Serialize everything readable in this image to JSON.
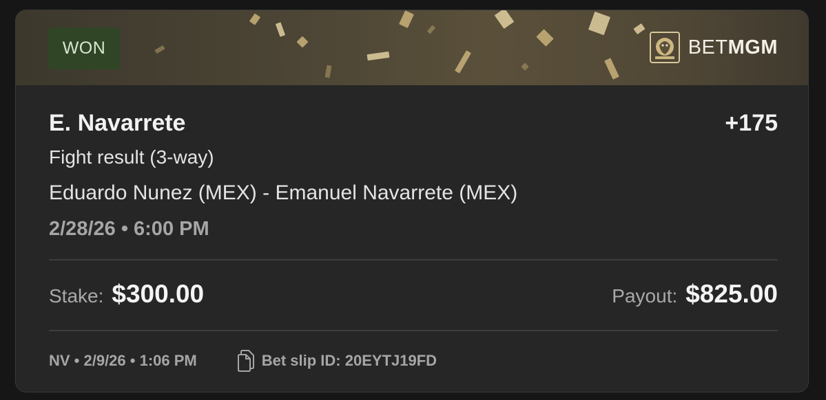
{
  "bet": {
    "status": "WON",
    "brand": {
      "prefix": "BET",
      "suffix": "MGM"
    },
    "selection": "E. Navarrete",
    "odds": "+175",
    "market": "Fight result (3-way)",
    "event": "Eduardo Nunez (MEX) - Emanuel Navarrete (MEX)",
    "event_time": "2/28/26 • 6:00 PM",
    "stake_label": "Stake:",
    "stake_value": "$300.00",
    "payout_label": "Payout:",
    "payout_value": "$825.00",
    "placed_meta": "NV • 2/9/26 • 1:06 PM",
    "slip_id": "Bet slip ID: 20EYTJ19FD"
  },
  "icons": {
    "brand_logo": "lion-crest-icon",
    "slip": "copy-document-icon"
  },
  "colors": {
    "won_badge_bg": "#2f4526",
    "banner_gold": "#c9b27a",
    "card_bg": "#262626"
  }
}
